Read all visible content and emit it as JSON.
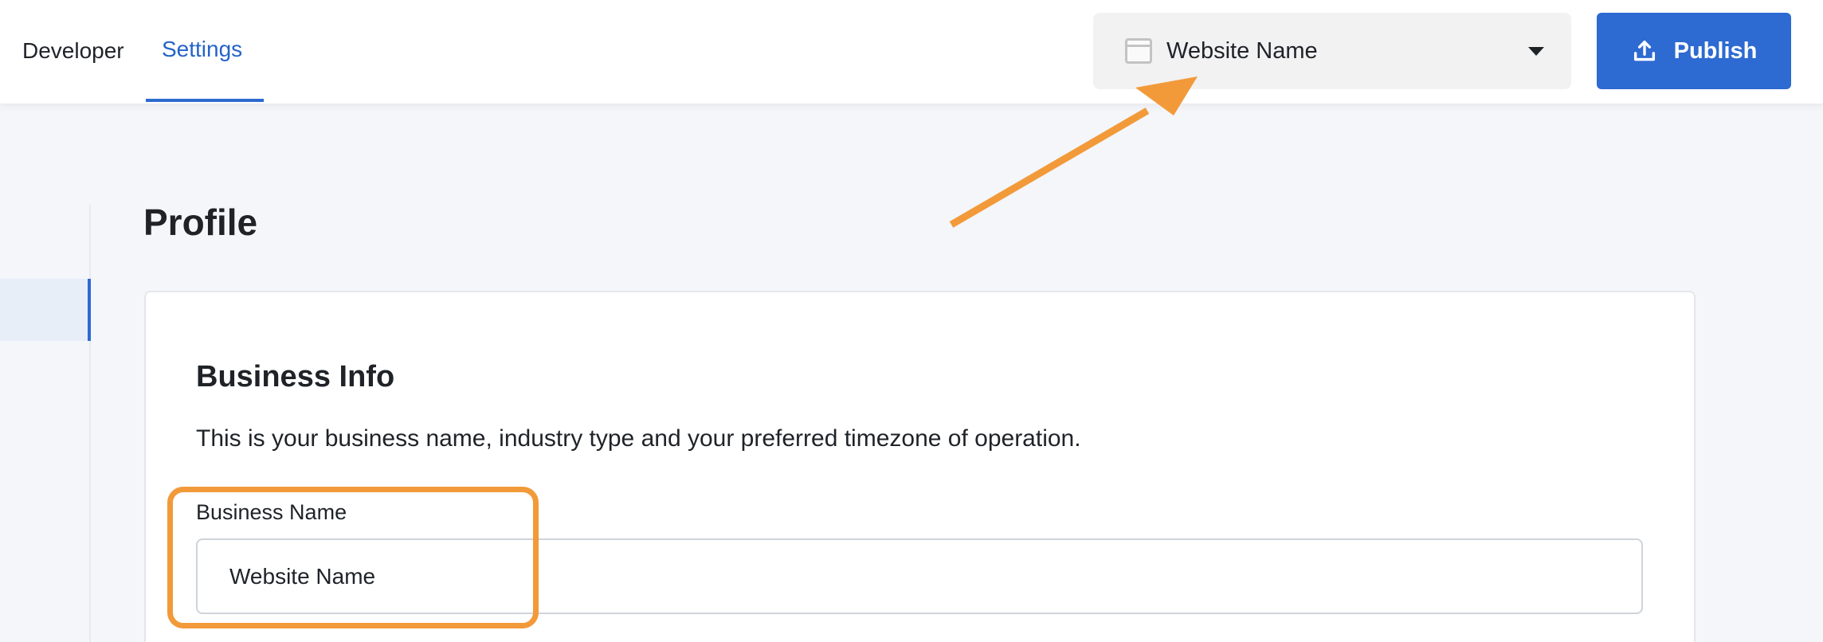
{
  "header": {
    "tabs": [
      {
        "label": "Developer",
        "active": false
      },
      {
        "label": "Settings",
        "active": true
      }
    ],
    "site_selector": {
      "icon": "browser-window-icon",
      "label": "Website Name",
      "caret_icon": "caret-down-icon"
    },
    "publish": {
      "icon": "upload-icon",
      "label": "Publish"
    }
  },
  "page": {
    "title": "Profile"
  },
  "section": {
    "title": "Business Info",
    "description": "This is your business name, industry type and your preferred timezone of operation.",
    "fields": [
      {
        "label": "Business Name",
        "value": "Website Name"
      }
    ]
  },
  "colors": {
    "accent": "#2d6ad1",
    "annotation": "#f29a3a"
  }
}
